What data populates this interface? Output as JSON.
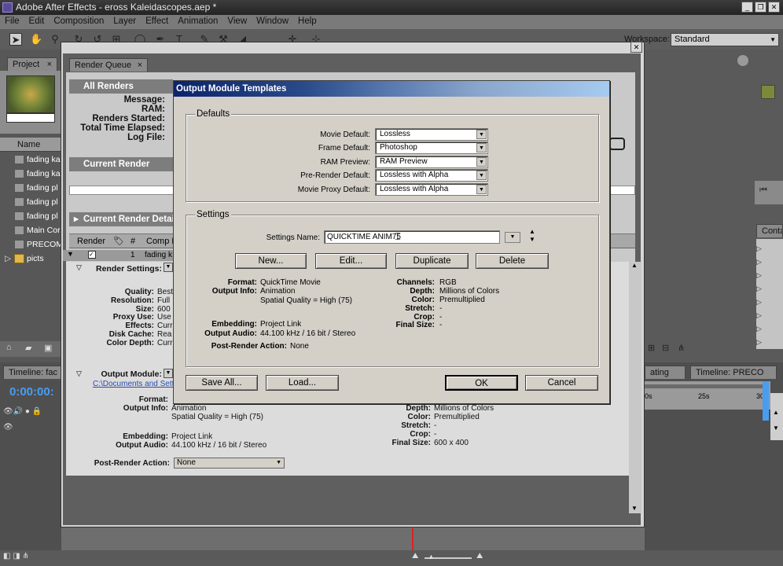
{
  "window": {
    "title": "Adobe After Effects - eross Kaleidascopes.aep *",
    "controls": [
      "_",
      "❐",
      "✕"
    ]
  },
  "menu": [
    "File",
    "Edit",
    "Composition",
    "Layer",
    "Effect",
    "Animation",
    "View",
    "Window",
    "Help"
  ],
  "workspace": {
    "label": "Workspace:",
    "value": "Standard"
  },
  "project": {
    "tab": "Project",
    "col_name": "Name",
    "items": [
      "fading ka",
      "fading ka",
      "fading pl",
      "fading pl",
      "fading pl",
      "Main Cor",
      "PRECOM",
      "picts"
    ]
  },
  "render_queue": {
    "tab": "Render Queue",
    "all_renders": "All Renders",
    "labels": [
      "Message:",
      "RAM:",
      "Renders Started:",
      "Total Time Elapsed:",
      "Log File:"
    ],
    "current_render": "Current Render",
    "current_render_details": "Current Render Details",
    "cols": [
      "Render",
      "#",
      "Comp N"
    ],
    "row": {
      "num": "1",
      "name": "fading k"
    },
    "render_settings_label": "Render Settings:",
    "settings": [
      {
        "k": "Quality:",
        "v": "Best"
      },
      {
        "k": "Resolution:",
        "v": "Full"
      },
      {
        "k": "Size:",
        "v": "600"
      },
      {
        "k": "Proxy Use:",
        "v": "Use"
      },
      {
        "k": "Effects:",
        "v": "Curr"
      },
      {
        "k": "Disk Cache:",
        "v": "Rea"
      },
      {
        "k": "Color Depth:",
        "v": "Curr"
      }
    ],
    "output_module_label": "Output Module:",
    "output_path": "C:\\Documents and Sett",
    "om_left": [
      {
        "k": "Format:",
        "v": ""
      },
      {
        "k": "Output Info:",
        "v": "Animation"
      },
      {
        "k": "",
        "v": "Spatial Quality = High (75)"
      },
      {
        "k": "Embedding:",
        "v": "Project Link"
      },
      {
        "k": "Output Audio:",
        "v": "44.100 kHz / 16 bit / Stereo"
      }
    ],
    "om_right": [
      {
        "k": "Depth:",
        "v": "Millions of Colors"
      },
      {
        "k": "Color:",
        "v": "Premultiplied"
      },
      {
        "k": "Stretch:",
        "v": "-"
      },
      {
        "k": "Crop:",
        "v": "-"
      },
      {
        "k": "Final Size:",
        "v": "600 x 400"
      }
    ],
    "post_render_label": "Post-Render Action:",
    "post_render_value": "None"
  },
  "timeline_left": {
    "tab": "Timeline: fac",
    "timecode": "0:00:00:"
  },
  "timeline_right": {
    "tab1": "ating",
    "tab2": "Timeline: PRECO",
    "ruler": [
      "0s",
      "25s",
      "30s"
    ]
  },
  "right_panel": {
    "tab": "Contai"
  },
  "dialog": {
    "title": "Output Module Templates",
    "defaults_label": "Defaults",
    "defaults": [
      {
        "k": "Movie Default:",
        "v": "Lossless"
      },
      {
        "k": "Frame Default:",
        "v": "Photoshop"
      },
      {
        "k": "RAM Preview:",
        "v": "RAM Preview"
      },
      {
        "k": "Pre-Render Default:",
        "v": "Lossless with Alpha"
      },
      {
        "k": "Movie Proxy Default:",
        "v": "Lossless with Alpha"
      }
    ],
    "settings_label": "Settings",
    "settings_name_label": "Settings Name:",
    "settings_name_value": "QUICKTIME ANIM75",
    "buttons_row": [
      "New...",
      "Edit...",
      "Duplicate",
      "Delete"
    ],
    "info_left": [
      {
        "k": "Format:",
        "v": "QuickTime Movie"
      },
      {
        "k": "Output Info:",
        "v": "Animation"
      },
      {
        "k": "",
        "v": "Spatial Quality = High (75)"
      },
      {
        "k": "Embedding:",
        "v": "Project Link"
      },
      {
        "k": "Output Audio:",
        "v": "44.100 kHz / 16 bit / Stereo"
      },
      {
        "k": "Post-Render Action:",
        "v": "None"
      }
    ],
    "info_right": [
      {
        "k": "Channels:",
        "v": "RGB"
      },
      {
        "k": "Depth:",
        "v": "Millions of Colors"
      },
      {
        "k": "Color:",
        "v": "Premultiplied"
      },
      {
        "k": "Stretch:",
        "v": "-"
      },
      {
        "k": "Crop:",
        "v": "-"
      },
      {
        "k": "Final Size:",
        "v": "-"
      }
    ],
    "save_all": "Save All...",
    "load": "Load...",
    "ok": "OK",
    "cancel": "Cancel"
  }
}
